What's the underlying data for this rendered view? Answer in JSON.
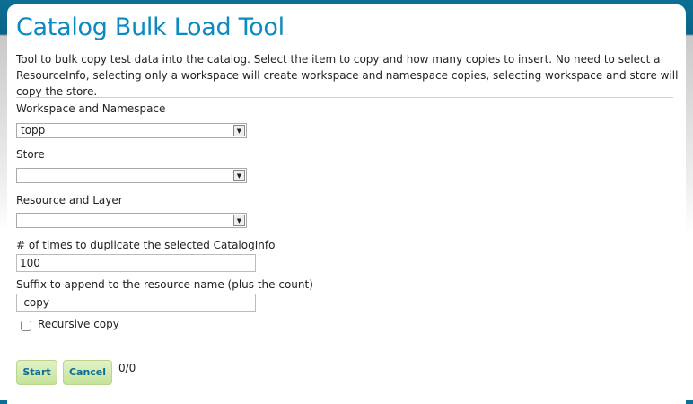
{
  "title": "Catalog Bulk Load Tool",
  "description": "Tool to bulk copy test data into the catalog. Select the item to copy and how many copies to insert. No need to select a ResourceInfo, selecting only a workspace will create workspace and namespace copies, selecting workspace and store will copy the store.",
  "form": {
    "workspace_label": "Workspace and Namespace",
    "workspace_value": "topp",
    "store_label": "Store",
    "store_value": "",
    "resource_label": "Resource and Layer",
    "resource_value": "",
    "times_label": "# of times to duplicate the selected CatalogInfo",
    "times_value": "100",
    "suffix_label": "Suffix to append to the resource name (plus the count)",
    "suffix_value": "-copy-",
    "recursive_label": "Recursive copy",
    "recursive_checked": false
  },
  "actions": {
    "start": "Start",
    "cancel": "Cancel",
    "progress": "0/0"
  },
  "colors": {
    "title": "#0a8ac0",
    "accent_rule": "#c5e09a",
    "header_bg": "#0b6f95"
  }
}
